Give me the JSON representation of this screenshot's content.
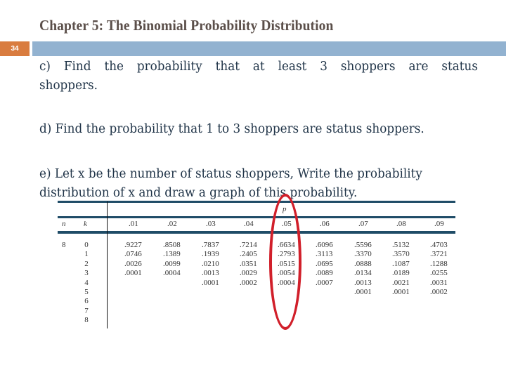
{
  "slide": {
    "title": "Chapter 5: The Binomial Probability Distribution",
    "page_number": "34",
    "colors": {
      "title_text": "#5b4f4a",
      "page_badge": "#d97c3f",
      "title_bar": "#92b2d0",
      "body_text": "#1f3347",
      "table_rule": "#1f4c67",
      "highlight_circle": "#d11f2a"
    }
  },
  "questions": {
    "c": "c) Find the probability that at least 3 shoppers are status shoppers.",
    "d": "d) Find the probability that 1 to 3 shoppers are status shoppers.",
    "e_line1": "e) Let x be the number of status shoppers, Write the probability",
    "e_line2": "distribution of x and draw a graph of this probability."
  },
  "table": {
    "p_label": "p",
    "n_header": "n",
    "k_header": "k",
    "n_value": "8",
    "p_headers": [
      ".01",
      ".02",
      ".03",
      ".04",
      ".05",
      ".06",
      ".07",
      ".08",
      ".09"
    ],
    "k_values": [
      "0",
      "1",
      "2",
      "3",
      "4",
      "5",
      "6",
      "7",
      "8"
    ],
    "columns": [
      [
        ".9227",
        ".0746",
        ".0026",
        ".0001",
        "",
        "",
        "",
        "",
        ""
      ],
      [
        ".8508",
        ".1389",
        ".0099",
        ".0004",
        "",
        "",
        "",
        "",
        ""
      ],
      [
        ".7837",
        ".1939",
        ".0210",
        ".0013",
        ".0001",
        "",
        "",
        "",
        ""
      ],
      [
        ".7214",
        ".2405",
        ".0351",
        ".0029",
        ".0002",
        "",
        "",
        "",
        ""
      ],
      [
        ".6634",
        ".2793",
        ".0515",
        ".0054",
        ".0004",
        "",
        "",
        "",
        ""
      ],
      [
        ".6096",
        ".3113",
        ".0695",
        ".0089",
        ".0007",
        "",
        "",
        "",
        ""
      ],
      [
        ".5596",
        ".3370",
        ".0888",
        ".0134",
        ".0013",
        ".0001",
        "",
        "",
        ""
      ],
      [
        ".5132",
        ".3570",
        ".1087",
        ".0189",
        ".0021",
        ".0001",
        "",
        "",
        ""
      ],
      [
        ".4703",
        ".3721",
        ".1288",
        ".0255",
        ".0031",
        ".0002",
        "",
        "",
        ""
      ]
    ],
    "highlighted_column": ".05"
  }
}
